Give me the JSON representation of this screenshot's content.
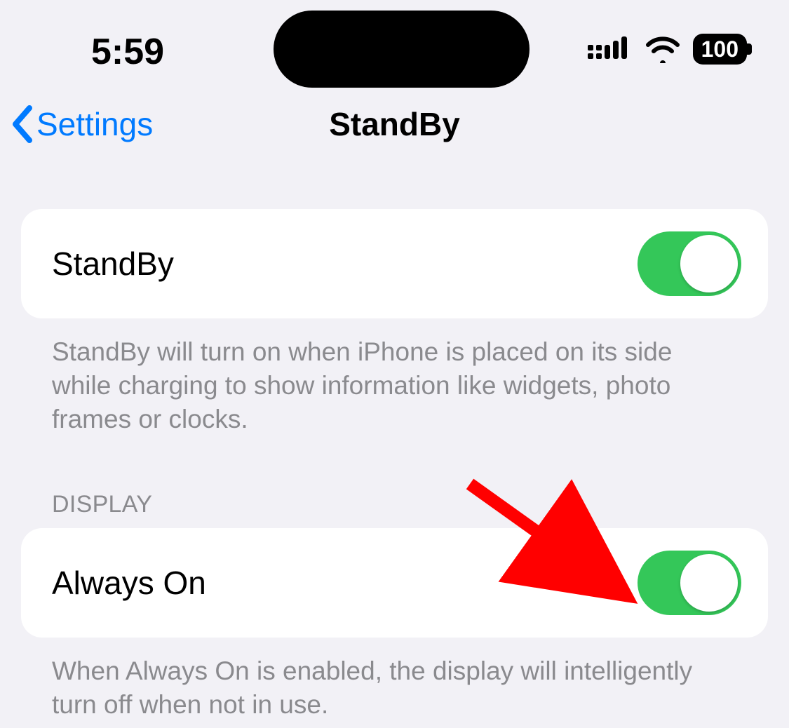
{
  "status_bar": {
    "time": "5:59",
    "battery": "100"
  },
  "nav": {
    "back_label": "Settings",
    "title": "StandBy"
  },
  "groups": [
    {
      "header": "",
      "row": {
        "label": "StandBy",
        "toggle_on": true
      },
      "footer": "StandBy will turn on when iPhone is placed on its side while charging to show information like widgets, photo frames or clocks."
    },
    {
      "header": "DISPLAY",
      "row": {
        "label": "Always On",
        "toggle_on": true
      },
      "footer": "When Always On is enabled, the display will intelligently turn off when not in use."
    }
  ],
  "colors": {
    "accent_blue": "#007aff",
    "toggle_green": "#34c759",
    "annotation_red": "#ff0000"
  }
}
